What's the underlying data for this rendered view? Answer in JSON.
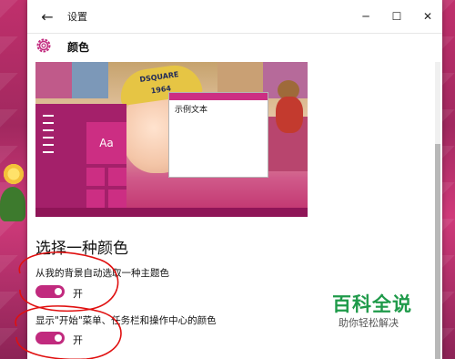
{
  "window": {
    "title": "设置",
    "controls": {
      "minimize": "─",
      "maximize": "☐",
      "close": "✕"
    },
    "back_glyph": "←"
  },
  "header": {
    "icon": "gear-icon",
    "title": "颜色",
    "accent": "#c12a7e"
  },
  "preview": {
    "tile_label": "Aa",
    "sample_window_text": "示例文本",
    "hat_text_1": "DSQUARE",
    "hat_text_2": "1964"
  },
  "section": {
    "title": "选择一种颜色"
  },
  "options": [
    {
      "label": "从我的背景自动选取一种主题色",
      "state": "开",
      "on": true
    },
    {
      "label": "显示\"开始\"菜单、任务栏和操作中心的颜色",
      "state": "开",
      "on": true
    }
  ],
  "watermark": {
    "main": "百科全说",
    "sub": "助你轻松解决"
  }
}
